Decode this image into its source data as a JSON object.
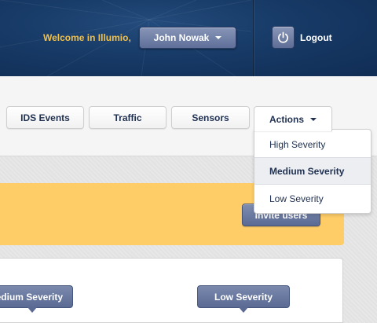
{
  "header": {
    "welcome": "Welcome in Illumio,",
    "user_name": "John Nowak",
    "logout_label": "Logout",
    "accent_color": "#f1c04a",
    "background_color": "#173a66"
  },
  "tabs": [
    {
      "label": "IDS Events"
    },
    {
      "label": "Traffic"
    },
    {
      "label": "Sensors"
    },
    {
      "label": "Actions"
    }
  ],
  "actions_menu": {
    "items": [
      {
        "label": "High Severity",
        "selected": false
      },
      {
        "label": "Medium Severity",
        "selected": true
      },
      {
        "label": "Low Severity",
        "selected": false
      }
    ]
  },
  "banner": {
    "button_label": "Invite users",
    "color": "#fecd68"
  },
  "panel": {
    "tooltips": [
      {
        "label": "Medium Severity"
      },
      {
        "label": "Low Severity"
      }
    ]
  },
  "icons": {
    "user_menu": "chevron-down-icon",
    "logout": "power-icon",
    "actions": "chevron-down-icon"
  }
}
